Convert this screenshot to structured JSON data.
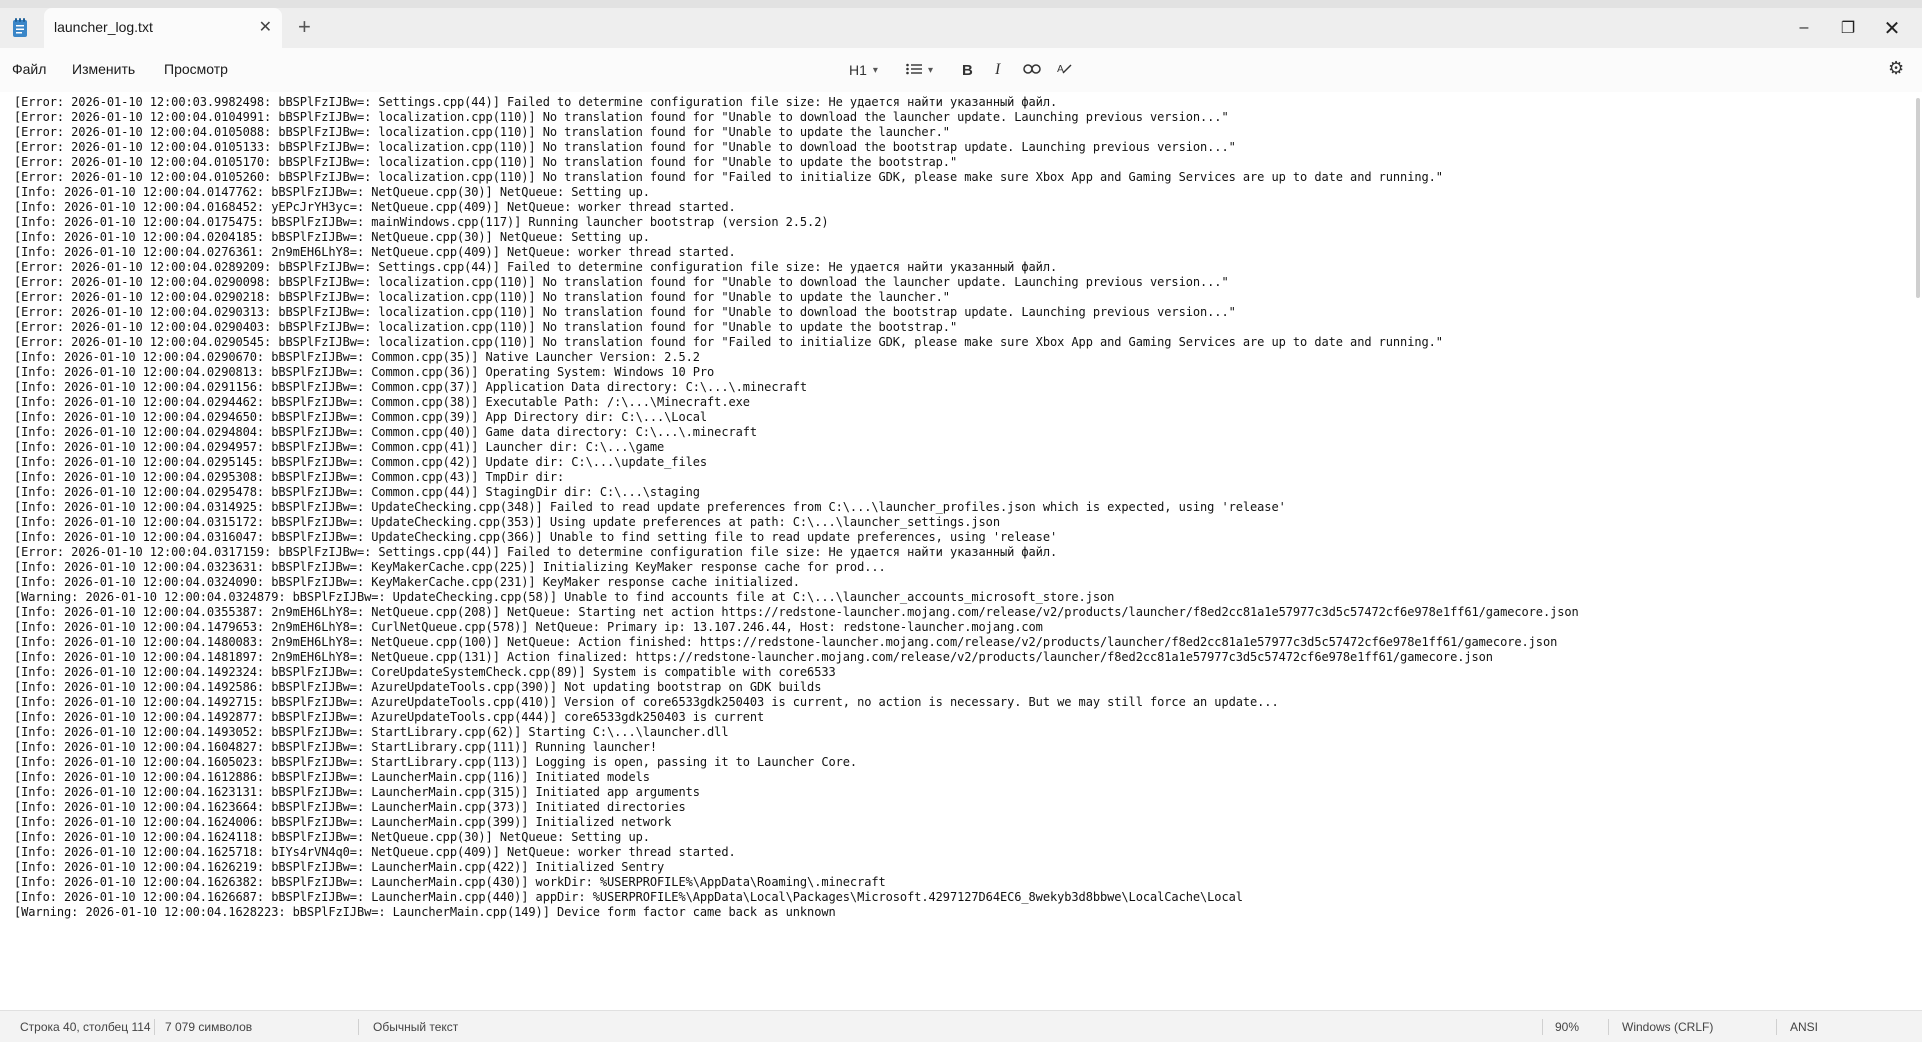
{
  "window": {
    "tab_title": "launcher_log.txt",
    "tab_close": "✕",
    "new_tab": "+",
    "minimize": "–",
    "maximize": "❐",
    "close": "✕"
  },
  "menu": {
    "file": "Файл",
    "edit": "Изменить",
    "view": "Просмотр"
  },
  "toolbar": {
    "heading": "H1",
    "bold": "B",
    "italic": "I",
    "link_icon": "link-icon",
    "list_icon": "list-icon",
    "clear_format_icon": "clear-format-icon",
    "settings_icon": "gear-icon"
  },
  "document": {
    "lines": [
      "[Error: 2026-01-10 12:00:03.9982498: bBSPlFzIJBw=: Settings.cpp(44)] Failed to determine configuration file size: Не удается найти указанный файл.",
      "[Error: 2026-01-10 12:00:04.0104991: bBSPlFzIJBw=: localization.cpp(110)] No translation found for \"Unable to download the launcher update. Launching previous version...\"",
      "[Error: 2026-01-10 12:00:04.0105088: bBSPlFzIJBw=: localization.cpp(110)] No translation found for \"Unable to update the launcher.\"",
      "[Error: 2026-01-10 12:00:04.0105133: bBSPlFzIJBw=: localization.cpp(110)] No translation found for \"Unable to download the bootstrap update. Launching previous version...\"",
      "[Error: 2026-01-10 12:00:04.0105170: bBSPlFzIJBw=: localization.cpp(110)] No translation found for \"Unable to update the bootstrap.\"",
      "[Error: 2026-01-10 12:00:04.0105260: bBSPlFzIJBw=: localization.cpp(110)] No translation found for \"Failed to initialize GDK, please make sure Xbox App and Gaming Services are up to date and running.\"",
      "[Info: 2026-01-10 12:00:04.0147762: bBSPlFzIJBw=: NetQueue.cpp(30)] NetQueue: Setting up.",
      "[Info: 2026-01-10 12:00:04.0168452: yEPcJrYH3yc=: NetQueue.cpp(409)] NetQueue: worker thread started.",
      "[Info: 2026-01-10 12:00:04.0175475: bBSPlFzIJBw=: mainWindows.cpp(117)] Running launcher bootstrap (version 2.5.2)",
      "[Info: 2026-01-10 12:00:04.0204185: bBSPlFzIJBw=: NetQueue.cpp(30)] NetQueue: Setting up.",
      "[Info: 2026-01-10 12:00:04.0276361: 2n9mEH6LhY8=: NetQueue.cpp(409)] NetQueue: worker thread started.",
      "[Error: 2026-01-10 12:00:04.0289209: bBSPlFzIJBw=: Settings.cpp(44)] Failed to determine configuration file size: Не удается найти указанный файл.",
      "[Error: 2026-01-10 12:00:04.0290098: bBSPlFzIJBw=: localization.cpp(110)] No translation found for \"Unable to download the launcher update. Launching previous version...\"",
      "[Error: 2026-01-10 12:00:04.0290218: bBSPlFzIJBw=: localization.cpp(110)] No translation found for \"Unable to update the launcher.\"",
      "[Error: 2026-01-10 12:00:04.0290313: bBSPlFzIJBw=: localization.cpp(110)] No translation found for \"Unable to download the bootstrap update. Launching previous version...\"",
      "[Error: 2026-01-10 12:00:04.0290403: bBSPlFzIJBw=: localization.cpp(110)] No translation found for \"Unable to update the bootstrap.\"",
      "[Error: 2026-01-10 12:00:04.0290545: bBSPlFzIJBw=: localization.cpp(110)] No translation found for \"Failed to initialize GDK, please make sure Xbox App and Gaming Services are up to date and running.\"",
      "[Info: 2026-01-10 12:00:04.0290670: bBSPlFzIJBw=: Common.cpp(35)] Native Launcher Version: 2.5.2",
      "[Info: 2026-01-10 12:00:04.0290813: bBSPlFzIJBw=: Common.cpp(36)] Operating System: Windows 10 Pro",
      "[Info: 2026-01-10 12:00:04.0291156: bBSPlFzIJBw=: Common.cpp(37)] Application Data directory: C:\\...\\.minecraft",
      "[Info: 2026-01-10 12:00:04.0294462: bBSPlFzIJBw=: Common.cpp(38)] Executable Path: /:\\...\\Minecraft.exe",
      "[Info: 2026-01-10 12:00:04.0294650: bBSPlFzIJBw=: Common.cpp(39)] App Directory dir: C:\\...\\Local",
      "[Info: 2026-01-10 12:00:04.0294804: bBSPlFzIJBw=: Common.cpp(40)] Game data directory: C:\\...\\.minecraft",
      "[Info: 2026-01-10 12:00:04.0294957: bBSPlFzIJBw=: Common.cpp(41)] Launcher dir: C:\\...\\game",
      "[Info: 2026-01-10 12:00:04.0295145: bBSPlFzIJBw=: Common.cpp(42)] Update dir: C:\\...\\update_files",
      "[Info: 2026-01-10 12:00:04.0295308: bBSPlFzIJBw=: Common.cpp(43)] TmpDir dir:",
      "[Info: 2026-01-10 12:00:04.0295478: bBSPlFzIJBw=: Common.cpp(44)] StagingDir dir: C:\\...\\staging",
      "[Info: 2026-01-10 12:00:04.0314925: bBSPlFzIJBw=: UpdateChecking.cpp(348)] Failed to read update preferences from C:\\...\\launcher_profiles.json which is expected, using 'release'",
      "[Info: 2026-01-10 12:00:04.0315172: bBSPlFzIJBw=: UpdateChecking.cpp(353)] Using update preferences at path: C:\\...\\launcher_settings.json",
      "[Info: 2026-01-10 12:00:04.0316047: bBSPlFzIJBw=: UpdateChecking.cpp(366)] Unable to find setting file to read update preferences, using 'release'",
      "[Error: 2026-01-10 12:00:04.0317159: bBSPlFzIJBw=: Settings.cpp(44)] Failed to determine configuration file size: Не удается найти указанный файл.",
      "[Info: 2026-01-10 12:00:04.0323631: bBSPlFzIJBw=: KeyMakerCache.cpp(225)] Initializing KeyMaker response cache for prod...",
      "[Info: 2026-01-10 12:00:04.0324090: bBSPlFzIJBw=: KeyMakerCache.cpp(231)] KeyMaker response cache initialized.",
      "[Warning: 2026-01-10 12:00:04.0324879: bBSPlFzIJBw=: UpdateChecking.cpp(58)] Unable to find accounts file at C:\\...\\launcher_accounts_microsoft_store.json",
      "[Info: 2026-01-10 12:00:04.0355387: 2n9mEH6LhY8=: NetQueue.cpp(208)] NetQueue: Starting net action https://redstone-launcher.mojang.com/release/v2/products/launcher/f8ed2cc81a1e57977c3d5c57472cf6e978e1ff61/gamecore.json",
      "[Info: 2026-01-10 12:00:04.1479653: 2n9mEH6LhY8=: CurlNetQueue.cpp(578)] NetQueue: Primary ip: 13.107.246.44, Host: redstone-launcher.mojang.com",
      "[Info: 2026-01-10 12:00:04.1480083: 2n9mEH6LhY8=: NetQueue.cpp(100)] NetQueue: Action finished: https://redstone-launcher.mojang.com/release/v2/products/launcher/f8ed2cc81a1e57977c3d5c57472cf6e978e1ff61/gamecore.json",
      "[Info: 2026-01-10 12:00:04.1481897: 2n9mEH6LhY8=: NetQueue.cpp(131)] Action finalized: https://redstone-launcher.mojang.com/release/v2/products/launcher/f8ed2cc81a1e57977c3d5c57472cf6e978e1ff61/gamecore.json",
      "[Info: 2026-01-10 12:00:04.1492324: bBSPlFzIJBw=: CoreUpdateSystemCheck.cpp(89)] System is compatible with core6533",
      "[Info: 2026-01-10 12:00:04.1492586: bBSPlFzIJBw=: AzureUpdateTools.cpp(390)] Not updating bootstrap on GDK builds",
      "[Info: 2026-01-10 12:00:04.1492715: bBSPlFzIJBw=: AzureUpdateTools.cpp(410)] Version of core6533gdk250403 is current, no action is necessary. But we may still force an update...",
      "[Info: 2026-01-10 12:00:04.1492877: bBSPlFzIJBw=: AzureUpdateTools.cpp(444)] core6533gdk250403 is current",
      "[Info: 2026-01-10 12:00:04.1493052: bBSPlFzIJBw=: StartLibrary.cpp(62)] Starting C:\\...\\launcher.dll",
      "[Info: 2026-01-10 12:00:04.1604827: bBSPlFzIJBw=: StartLibrary.cpp(111)] Running launcher!",
      "[Info: 2026-01-10 12:00:04.1605023: bBSPlFzIJBw=: StartLibrary.cpp(113)] Logging is open, passing it to Launcher Core.",
      "[Info: 2026-01-10 12:00:04.1612886: bBSPlFzIJBw=: LauncherMain.cpp(116)] Initiated models",
      "[Info: 2026-01-10 12:00:04.1623131: bBSPlFzIJBw=: LauncherMain.cpp(315)] Initiated app arguments",
      "[Info: 2026-01-10 12:00:04.1623664: bBSPlFzIJBw=: LauncherMain.cpp(373)] Initiated directories",
      "[Info: 2026-01-10 12:00:04.1624006: bBSPlFzIJBw=: LauncherMain.cpp(399)] Initialized network",
      "[Info: 2026-01-10 12:00:04.1624118: bBSPlFzIJBw=: NetQueue.cpp(30)] NetQueue: Setting up.",
      "[Info: 2026-01-10 12:00:04.1625718: bIYs4rVN4q0=: NetQueue.cpp(409)] NetQueue: worker thread started.",
      "[Info: 2026-01-10 12:00:04.1626219: bBSPlFzIJBw=: LauncherMain.cpp(422)] Initialized Sentry",
      "[Info: 2026-01-10 12:00:04.1626382: bBSPlFzIJBw=: LauncherMain.cpp(430)] workDir: %USERPROFILE%\\AppData\\Roaming\\.minecraft",
      "[Info: 2026-01-10 12:00:04.1626687: bBSPlFzIJBw=: LauncherMain.cpp(440)] appDir: %USERPROFILE%\\AppData\\Local\\Packages\\Microsoft.4297127D64EC6_8wekyb3d8bbwe\\LocalCache\\Local",
      "[Warning: 2026-01-10 12:00:04.1628223: bBSPlFzIJBw=: LauncherMain.cpp(149)] Device form factor came back as unknown"
    ]
  },
  "status": {
    "position": "Строка 40, столбец 114",
    "chars": "7 079 символов",
    "format": "Обычный текст",
    "zoom": "90%",
    "line_endings": "Windows (CRLF)",
    "encoding": "ANSI"
  }
}
